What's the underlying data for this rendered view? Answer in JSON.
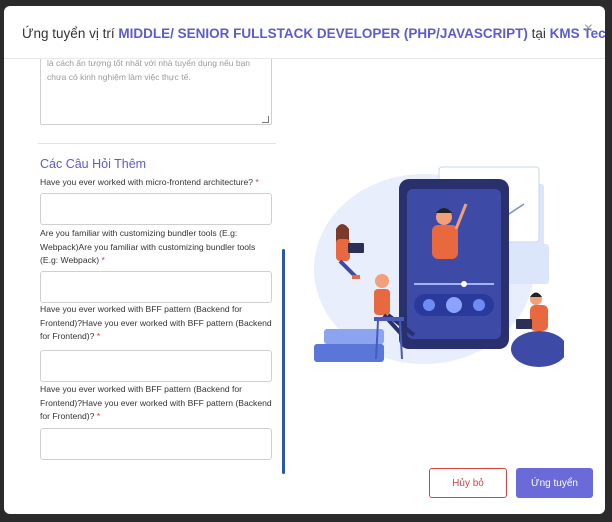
{
  "modal": {
    "title_prefix": "Ứng tuyển vị trí ",
    "job_title": "MIDDLE/ SENIOR FULLSTACK DEVELOPER (PHP/JAVASCRIPT)",
    "title_mid": " tại ",
    "company": "KMS Technology",
    "close_symbol": "×"
  },
  "form": {
    "cover_letter_text": "là cách ấn tượng tốt nhất với nhà tuyển dụng nếu bạn chưa có kinh nghiệm làm việc thực tế.",
    "section_title": "Các Câu Hỏi Thêm",
    "questions": [
      {
        "text": "Have you ever worked with micro-frontend architecture?",
        "required": "*",
        "value": ""
      },
      {
        "text": "Are you familiar with customizing bundler tools (E.g: Webpack)Are you familiar with customizing bundler tools (E.g: Webpack)",
        "required": "*",
        "value": ""
      },
      {
        "text": "Have you ever worked with BFF pattern (Backend for Frontend)?Have you ever worked with BFF pattern (Backend for Frontend)?",
        "required": "*",
        "value": ""
      },
      {
        "text": "Have you ever worked with BFF pattern (Backend for Frontend)?Have you ever worked with BFF pattern (Backend for Frontend)?",
        "required": "*",
        "value": ""
      }
    ]
  },
  "actions": {
    "cancel_label": "Hủy bỏ",
    "apply_label": "Ứng tuyển"
  },
  "colors": {
    "accent": "#5b5bd6",
    "danger": "#d9413d",
    "primary_button": "#6b6ad9"
  }
}
